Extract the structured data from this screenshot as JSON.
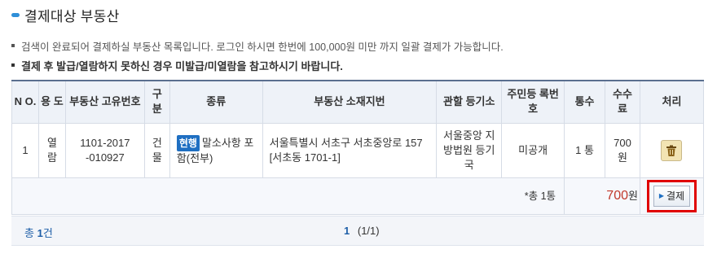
{
  "section": {
    "title": "결제대상 부동산"
  },
  "notes": [
    "검색이 완료되어 결제하실 부동산 목록입니다. 로그인 하시면 한번에 100,000원 미만 까지 일괄 결제가 가능합니다.",
    "결제 후 발급/열람하지 못하신 경우 미발급/미열람을 참고하시기 바랍니다."
  ],
  "table": {
    "headers": {
      "no": "N O.",
      "usage": "용 도",
      "unique": "부동산 고유번호",
      "gubun": "구 분",
      "kind": "종류",
      "address": "부동산 소재지번",
      "registry": "관할 등기소",
      "rrn": "주민등 록번호",
      "copies": "통수",
      "fee": "수수 료",
      "action": "처리"
    },
    "row": {
      "no": "1",
      "usage": "열 람",
      "unique": "1101-2017 -010927",
      "gubun": "건 물",
      "kind_badge": "현행",
      "kind_text": "말소사항 포함(전부)",
      "address": "서울특별시 서초구 서초중앙로 157 [서초동 1701-1]",
      "registry": "서울중앙 지방법원 등기국",
      "rrn": "미공개",
      "copies": "1 통",
      "fee": "700 원"
    },
    "total": {
      "count_label": "*총 1통",
      "amount": "700",
      "won": "원",
      "pay_button": "결제"
    }
  },
  "footer": {
    "total_label": "총",
    "total_num": "1",
    "total_unit": "건",
    "page_current": "1",
    "page_info": "(1/1)"
  },
  "colors": {
    "accent": "#1f6fc2",
    "highlight_box": "#e00000",
    "amount": "#c0392b"
  }
}
